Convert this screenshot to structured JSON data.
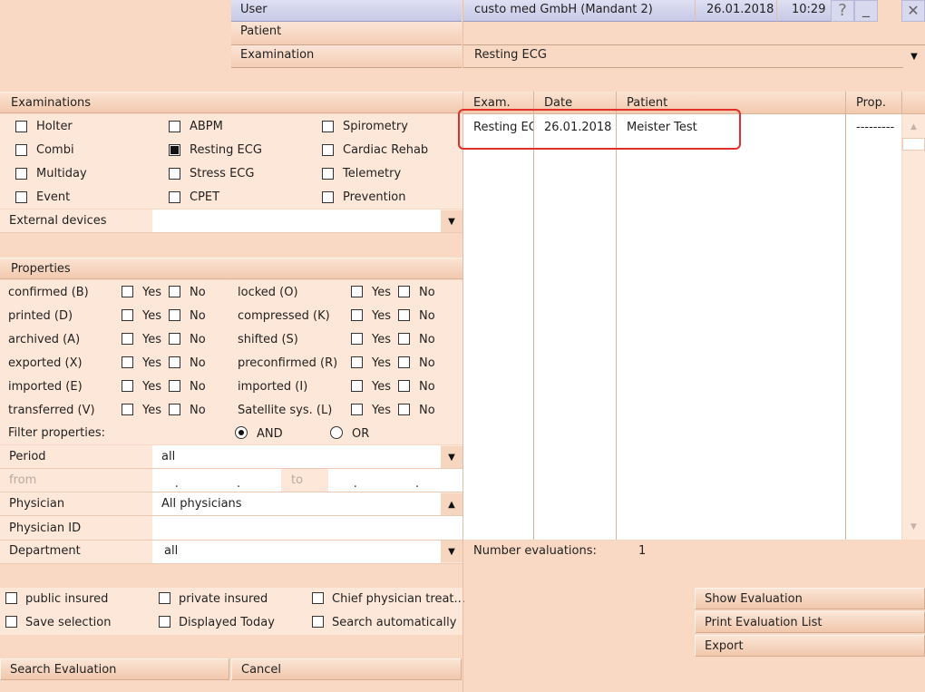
{
  "header": {
    "user_label": "User",
    "user_value": "custo med GmbH (Mandant 2)",
    "date": "26.01.2018",
    "time": "10:29",
    "help_glyph": "?",
    "minimize_glyph": "_",
    "close_glyph": "✕",
    "patient_label": "Patient",
    "patient_value": "",
    "examination_label": "Examination",
    "examination_value": "Resting ECG"
  },
  "examinations": {
    "title": "Examinations",
    "items": [
      {
        "label": "Holter",
        "checked": false
      },
      {
        "label": "ABPM",
        "checked": false
      },
      {
        "label": "Spirometry",
        "checked": false
      },
      {
        "label": "Combi",
        "checked": false
      },
      {
        "label": "Resting ECG",
        "checked": true
      },
      {
        "label": "Cardiac Rehab",
        "checked": false
      },
      {
        "label": "Multiday",
        "checked": false
      },
      {
        "label": "Stress ECG",
        "checked": false
      },
      {
        "label": "Telemetry",
        "checked": false
      },
      {
        "label": "Event",
        "checked": false
      },
      {
        "label": "CPET",
        "checked": false
      },
      {
        "label": "Prevention",
        "checked": false
      }
    ],
    "external_devices_label": "External devices",
    "external_devices_value": ""
  },
  "properties": {
    "title": "Properties",
    "yes": "Yes",
    "no": "No",
    "left": [
      "confirmed (B)",
      "printed (D)",
      "archived (A)",
      "exported (X)",
      "imported (E)",
      "transferred (V)"
    ],
    "right": [
      "locked (O)",
      "compressed (K)",
      "shifted (S)",
      "preconfirmed (R)",
      "imported (I)",
      "Satellite sys. (L)"
    ],
    "filter_label": "Filter properties:",
    "and_label": "AND",
    "or_label": "OR",
    "selected_mode": "AND"
  },
  "filters": {
    "period_label": "Period",
    "period_value": "all",
    "from_label": "from",
    "from_value": ". .",
    "to_label": "to",
    "to_value": ". .",
    "physician_label": "Physician",
    "physician_value": "All physicians",
    "physician_id_label": "Physician ID",
    "physician_id_value": "",
    "department_label": "Department",
    "department_value": "all"
  },
  "options": {
    "public_insured": "public insured",
    "private_insured": "private insured",
    "chief_physician": "Chief physician treat...",
    "save_selection": "Save selection",
    "displayed_today": "Displayed Today",
    "search_automatically": "Search automatically"
  },
  "buttons": {
    "search": "Search Evaluation",
    "cancel": "Cancel",
    "show": "Show Evaluation",
    "print": "Print Evaluation List",
    "export": "Export"
  },
  "results": {
    "columns": [
      "Exam.",
      "Date",
      "Patient",
      "Prop."
    ],
    "rows": [
      {
        "exam": "Resting ECG",
        "date": "26.01.2018",
        "patient": "Meister Test",
        "prop": "---------"
      }
    ],
    "count_label": "Number evaluations:",
    "count_value": "1"
  },
  "colors": {
    "background": "#f9d9c3",
    "user_bar": "#c8c9e6",
    "highlight": "#e0302a"
  }
}
